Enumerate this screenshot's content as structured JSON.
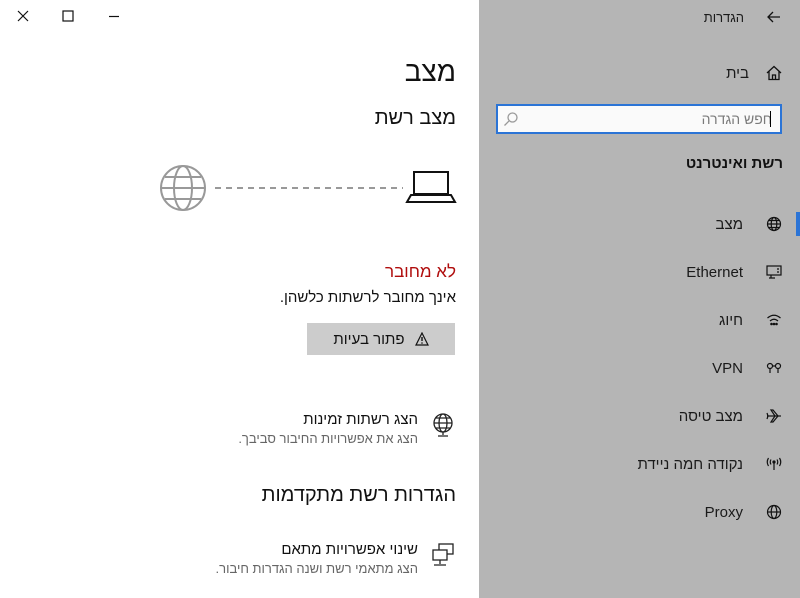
{
  "window": {
    "title": "הגדרות",
    "controls": [
      "close-icon",
      "maximize-icon",
      "minimize-icon"
    ]
  },
  "sidebar": {
    "back_icon": "arrow-back-icon",
    "home": {
      "label": "בית",
      "icon": "home-icon"
    },
    "search": {
      "value": "",
      "placeholder": "חפש הגדרה",
      "icon": "search-icon"
    },
    "section_title": "רשת ואינטרנט",
    "items": [
      {
        "label": "מצב",
        "icon": "globe-status-icon",
        "selected": true
      },
      {
        "label": "Ethernet",
        "icon": "ethernet-icon",
        "selected": false
      },
      {
        "label": "חיוג",
        "icon": "dialup-icon",
        "selected": false
      },
      {
        "label": "VPN",
        "icon": "vpn-icon",
        "selected": false
      },
      {
        "label": "מצב טיסה",
        "icon": "airplane-icon",
        "selected": false
      },
      {
        "label": "נקודה חמה ניידת",
        "icon": "hotspot-icon",
        "selected": false
      },
      {
        "label": "Proxy",
        "icon": "globe-icon",
        "selected": false
      }
    ],
    "accent_color": "#2b74d6"
  },
  "main": {
    "title": "מצב",
    "network_status_title": "מצב רשת",
    "status_text": "לא מחובר",
    "status_color": "#b00d0d",
    "status_desc": "אינך מחובר לרשתות כלשהן.",
    "troubleshoot_label": "פתור בעיות",
    "show_networks": {
      "title": "הצג רשתות זמינות",
      "desc": "הצג את אפשרויות החיבור סביבך."
    },
    "advanced_title": "הגדרות רשת מתקדמות",
    "change_adapter": {
      "title": "שינוי אפשרויות מתאם",
      "desc": "הצג מתאמי רשת ושנה הגדרות חיבור."
    }
  }
}
